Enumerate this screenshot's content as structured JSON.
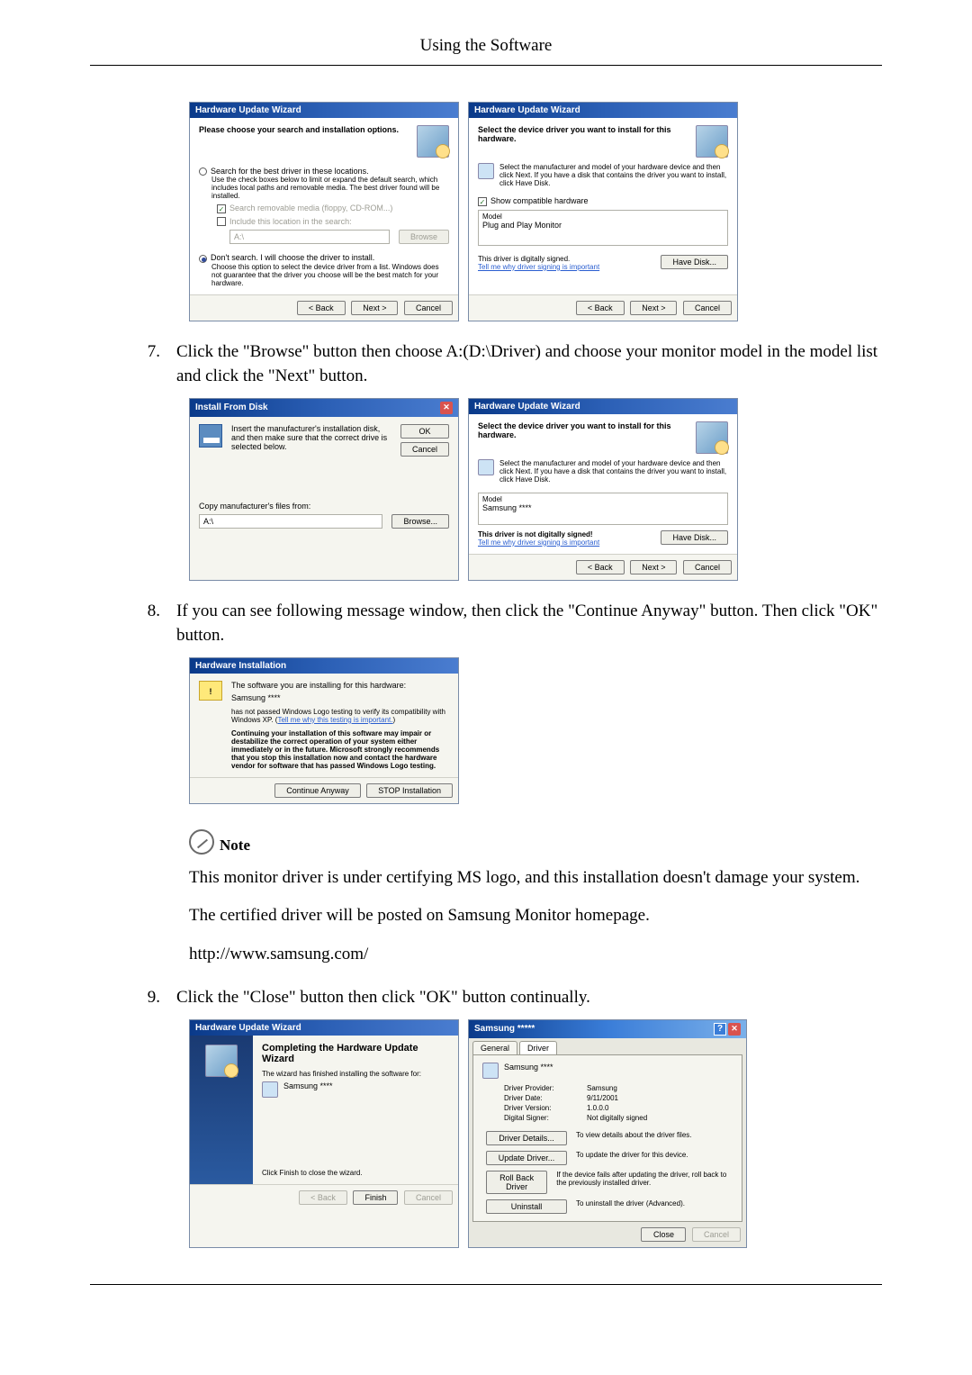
{
  "page_header": "Using the Software",
  "dialog1": {
    "title": "Hardware Update Wizard",
    "heading": "Please choose your search and installation options.",
    "opt1_label": "Search for the best driver in these locations.",
    "opt1_desc": "Use the check boxes below to limit or expand the default search, which includes local paths and removable media. The best driver found will be installed.",
    "chk1": "Search removable media (floppy, CD-ROM...)",
    "chk2": "Include this location in the search:",
    "path": "A:\\",
    "browse": "Browse",
    "opt2_label": "Don't search. I will choose the driver to install.",
    "opt2_desc": "Choose this option to select the device driver from a list. Windows does not guarantee that the driver you choose will be the best match for your hardware.",
    "back": "< Back",
    "next": "Next >",
    "cancel": "Cancel"
  },
  "dialog2": {
    "title": "Hardware Update Wizard",
    "heading": "Select the device driver you want to install for this hardware.",
    "desc": "Select the manufacturer and model of your hardware device and then click Next. If you have a disk that contains the driver you want to install, click Have Disk.",
    "show_compat": "Show compatible hardware",
    "model_hdr": "Model",
    "model_item": "Plug and Play Monitor",
    "signed": "This driver is digitally signed.",
    "tellme": "Tell me why driver signing is important",
    "havedisk": "Have Disk...",
    "back": "< Back",
    "next": "Next >",
    "cancel": "Cancel"
  },
  "step7_num": "7.",
  "step7_text": "Click the \"Browse\" button then choose A:(D:\\Driver) and choose your monitor model in the model list and click the \"Next\" button.",
  "dialog3": {
    "title": "Install From Disk",
    "desc": "Insert the manufacturer's installation disk, and then make sure that the correct drive is selected below.",
    "ok": "OK",
    "cancel": "Cancel",
    "copy_label": "Copy manufacturer's files from:",
    "path": "A:\\",
    "browse": "Browse..."
  },
  "dialog4": {
    "title": "Hardware Update Wizard",
    "heading": "Select the device driver you want to install for this hardware.",
    "desc": "Select the manufacturer and model of your hardware device and then click Next. If you have a disk that contains the driver you want to install, click Have Disk.",
    "model_hdr": "Model",
    "model_item": "Samsung ****",
    "not_signed": "This driver is not digitally signed!",
    "tellme": "Tell me why driver signing is important",
    "havedisk": "Have Disk...",
    "back": "< Back",
    "next": "Next >",
    "cancel": "Cancel"
  },
  "step8_num": "8.",
  "step8_text": "If you can see following message window, then click the \"Continue Anyway\" button. Then click \"OK\" button.",
  "dialog5": {
    "title": "Hardware Installation",
    "line1": "The software you are installing for this hardware:",
    "device": "Samsung ****",
    "line2a": "has not passed Windows Logo testing to verify its compatibility with Windows XP. (",
    "line2_link": "Tell me why this testing is important.",
    "line2b": ")",
    "bold_text": "Continuing your installation of this software may impair or destabilize the correct operation of your system either immediately or in the future. Microsoft strongly recommends that you stop this installation now and contact the hardware vendor for software that has passed Windows Logo testing.",
    "continue": "Continue Anyway",
    "stop": "STOP Installation"
  },
  "note_label": "Note",
  "note_p1": "This monitor driver is under certifying MS logo, and this installation doesn't damage your system.",
  "note_p2": "The certified driver will be posted on Samsung Monitor homepage.",
  "note_url": "http://www.samsung.com/",
  "step9_num": "9.",
  "step9_text": "Click the \"Close\" button then click \"OK\" button continually.",
  "dialog6": {
    "title": "Hardware Update Wizard",
    "heading": "Completing the Hardware Update Wizard",
    "line1": "The wizard has finished installing the software for:",
    "device": "Samsung ****",
    "line2": "Click Finish to close the wizard.",
    "back": "< Back",
    "finish": "Finish",
    "cancel": "Cancel"
  },
  "dialog7": {
    "title": "Samsung *****",
    "tab_general": "General",
    "tab_driver": "Driver",
    "device": "Samsung ****",
    "provider_l": "Driver Provider:",
    "provider_v": "Samsung",
    "date_l": "Driver Date:",
    "date_v": "9/11/2001",
    "version_l": "Driver Version:",
    "version_v": "1.0.0.0",
    "signer_l": "Digital Signer:",
    "signer_v": "Not digitally signed",
    "btn_details": "Driver Details...",
    "desc_details": "To view details about the driver files.",
    "btn_update": "Update Driver...",
    "desc_update": "To update the driver for this device.",
    "btn_rollback": "Roll Back Driver",
    "desc_rollback": "If the device fails after updating the driver, roll back to the previously installed driver.",
    "btn_uninstall": "Uninstall",
    "desc_uninstall": "To uninstall the driver (Advanced).",
    "close": "Close",
    "cancel": "Cancel"
  }
}
